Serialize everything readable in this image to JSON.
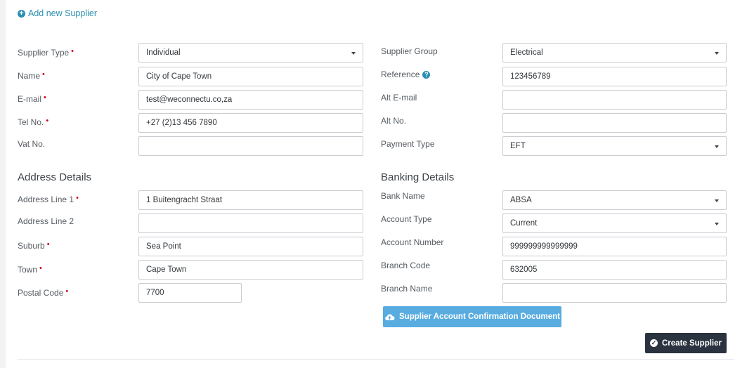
{
  "header": {
    "add_link": "Add new Supplier"
  },
  "left_fields": {
    "supplier_type": {
      "label": "Supplier Type",
      "value": "Individual"
    },
    "name": {
      "label": "Name",
      "value": "City of Cape Town"
    },
    "email": {
      "label": "E-mail",
      "value": "test@weconnectu.co,za"
    },
    "tel": {
      "label": "Tel No.",
      "value": "+27 (2)13 456 7890"
    },
    "vat": {
      "label": "Vat No.",
      "value": ""
    }
  },
  "right_fields": {
    "supplier_group": {
      "label": "Supplier Group",
      "value": "Electrical"
    },
    "reference": {
      "label": "Reference",
      "value": "123456789"
    },
    "alt_email": {
      "label": "Alt E-mail",
      "value": ""
    },
    "alt_no": {
      "label": "Alt No.",
      "value": ""
    },
    "payment_type": {
      "label": "Payment Type",
      "value": "EFT"
    }
  },
  "address": {
    "heading": "Address Details",
    "line1": {
      "label": "Address Line 1",
      "value": "1 Buitengracht Straat"
    },
    "line2": {
      "label": "Address Line 2",
      "value": ""
    },
    "suburb": {
      "label": "Suburb",
      "value": "Sea Point"
    },
    "town": {
      "label": "Town",
      "value": "Cape Town"
    },
    "postal": {
      "label": "Postal Code",
      "value": "7700"
    }
  },
  "banking": {
    "heading": "Banking Details",
    "bank_name": {
      "label": "Bank Name",
      "value": "ABSA"
    },
    "account_type": {
      "label": "Account Type",
      "value": "Current"
    },
    "account_number": {
      "label": "Account Number",
      "value": "999999999999999"
    },
    "branch_code": {
      "label": "Branch Code",
      "value": "632005"
    },
    "branch_name": {
      "label": "Branch Name",
      "value": ""
    }
  },
  "buttons": {
    "upload": "Supplier Account Confirmation Document",
    "create": "Create Supplier"
  },
  "required_marker": "•",
  "help_icon_glyph": "?",
  "colors": {
    "accent": "#2a8fb0",
    "required": "#d0021b",
    "upload_button": "#58ace0",
    "create_button": "#2b3340"
  }
}
